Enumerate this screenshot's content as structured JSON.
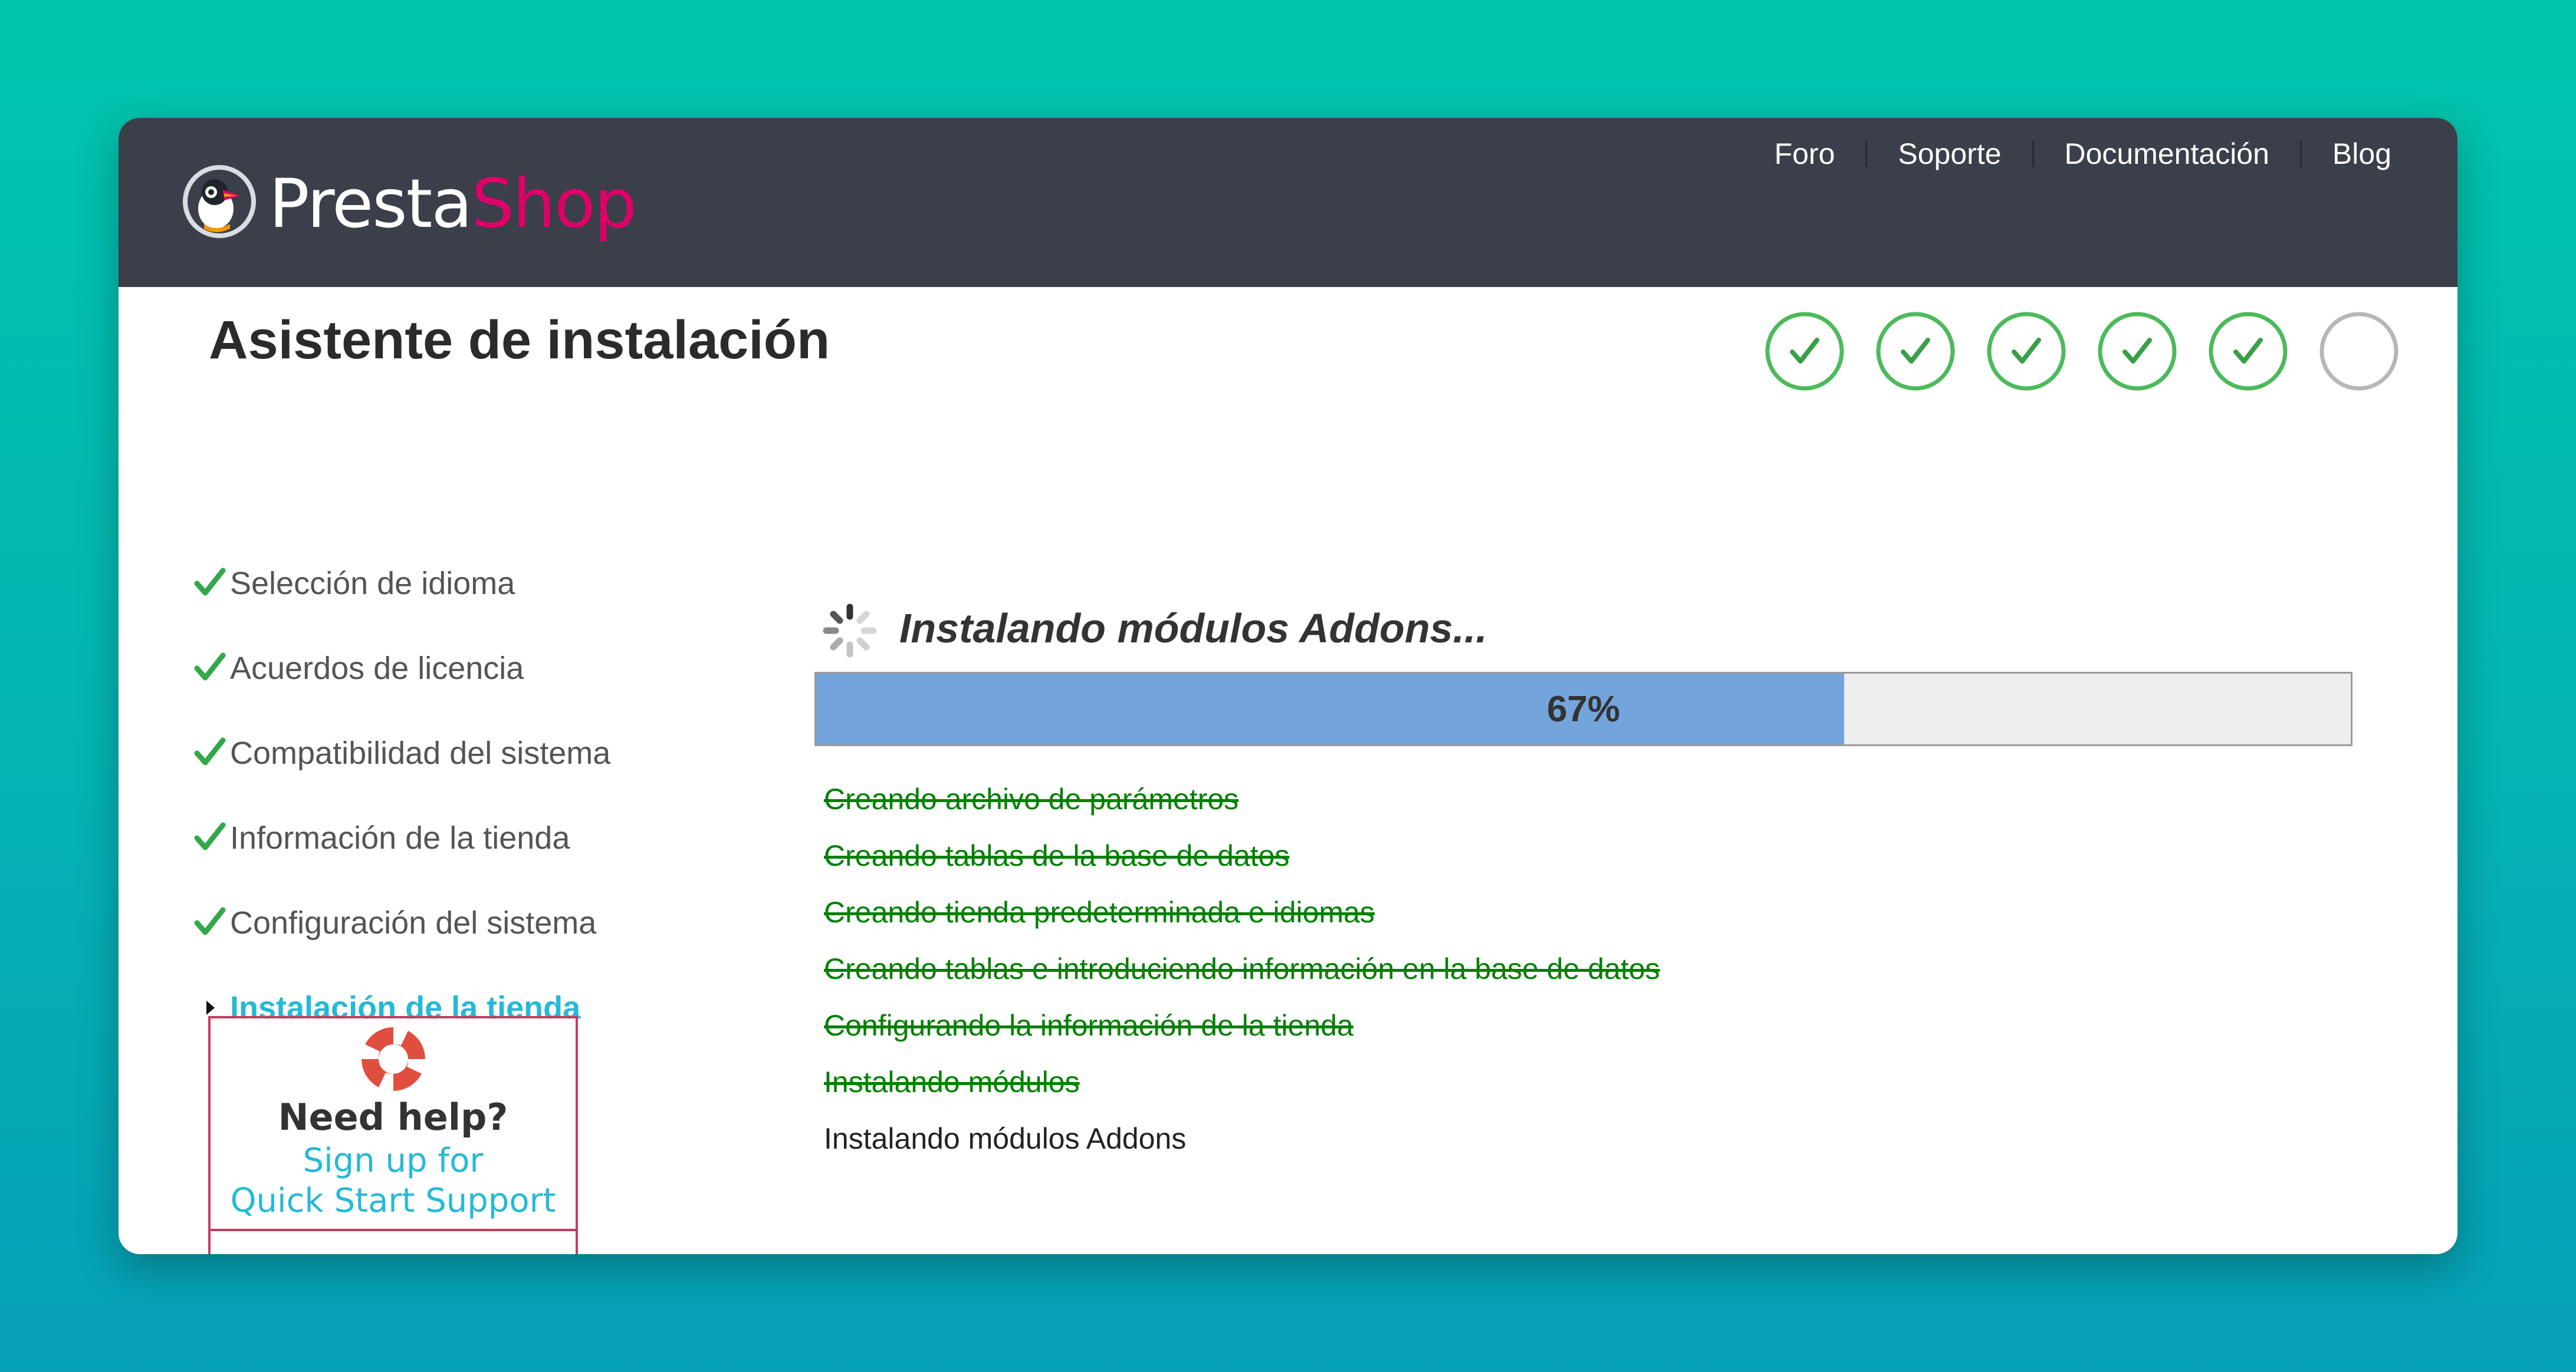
{
  "header": {
    "logo": {
      "part1": "Presta",
      "part2": "Shop"
    },
    "nav": [
      {
        "label": "Foro"
      },
      {
        "label": "Soporte"
      },
      {
        "label": "Documentación"
      },
      {
        "label": "Blog"
      }
    ]
  },
  "page_title": "Asistente de instalación",
  "step_indicator": {
    "total": 6,
    "completed": 5,
    "done_color": "#4cba5a",
    "pending_color": "#b7b7b7"
  },
  "sidebar": {
    "items": [
      {
        "label": "Selección de idioma",
        "state": "done"
      },
      {
        "label": "Acuerdos de licencia",
        "state": "done"
      },
      {
        "label": "Compatibilidad del sistema",
        "state": "done"
      },
      {
        "label": "Información de la tienda",
        "state": "done"
      },
      {
        "label": "Configuración del sistema",
        "state": "done"
      },
      {
        "label": "Instalación de la tienda",
        "state": "current"
      }
    ]
  },
  "help": {
    "title": "Need help?",
    "line1": "Sign up for",
    "line2": "Quick Start Support"
  },
  "main": {
    "heading": "Instalando módulos Addons...",
    "progress": {
      "percent": 67,
      "label": "67%"
    },
    "tasks": [
      {
        "label": "Creando archivo de parámetros",
        "state": "done"
      },
      {
        "label": "Creando tablas de la base de datos",
        "state": "done"
      },
      {
        "label": "Creando tienda predeterminada e idiomas",
        "state": "done"
      },
      {
        "label": "Creando tablas e introduciendo información en la base de datos",
        "state": "done"
      },
      {
        "label": "Configurando la información de la tienda",
        "state": "done"
      },
      {
        "label": "Instalando módulos",
        "state": "done"
      },
      {
        "label": "Instalando módulos Addons",
        "state": "active"
      }
    ]
  },
  "colors": {
    "header_bg": "#3a3f4a",
    "brand_pink": "#df0067",
    "accent_cyan": "#25b9d7",
    "check_green": "#32a84b",
    "task_done_green": "#008000",
    "progress_fill": "#74a4dc"
  }
}
